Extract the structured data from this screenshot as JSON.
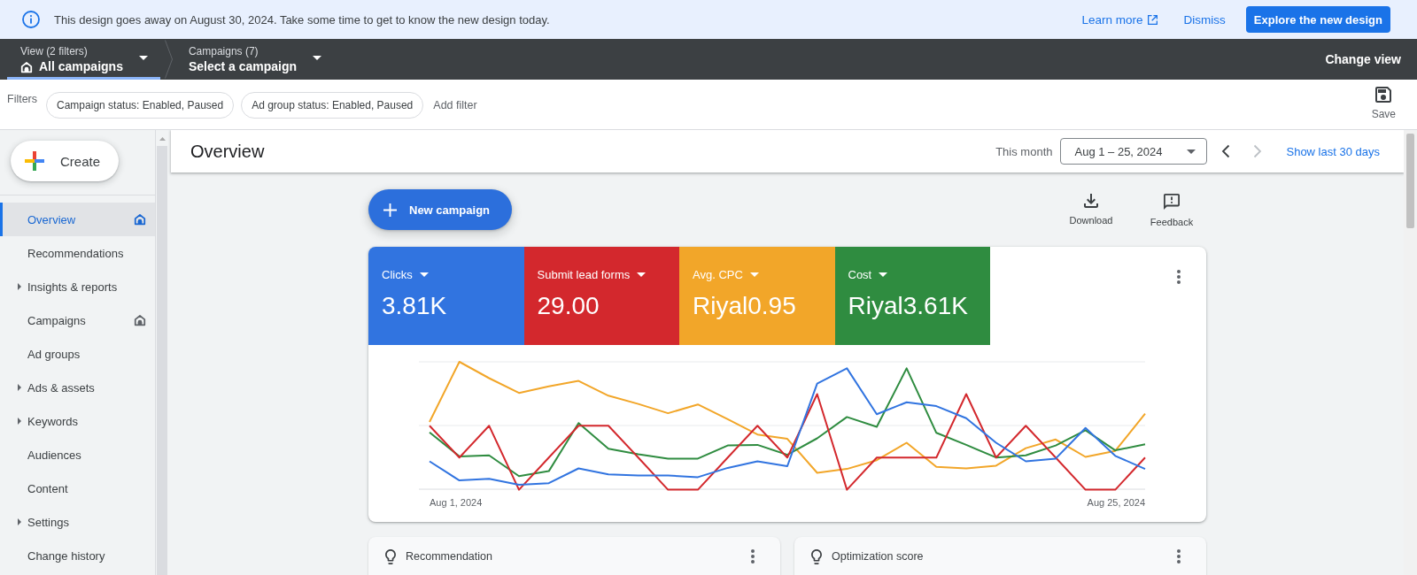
{
  "banner": {
    "message": "This design goes away on August 30, 2024. Take some time to get to know the new design today.",
    "learn_more": "Learn more",
    "dismiss": "Dismiss",
    "explore": "Explore the new design"
  },
  "navbar": {
    "crumbs": [
      {
        "label": "View (2 filters)",
        "value": "All campaigns",
        "home": true,
        "selected": true
      },
      {
        "label": "Campaigns (7)",
        "value": "Select a campaign",
        "home": false,
        "selected": false
      }
    ],
    "change_view": "Change view"
  },
  "filters": {
    "label": "Filters",
    "chips": [
      "Campaign status: Enabled, Paused",
      "Ad group status: Enabled, Paused"
    ],
    "add_filter": "Add filter",
    "save": "Save"
  },
  "sidebar": {
    "create": "Create",
    "items": [
      {
        "label": "Overview",
        "kind": "page",
        "home": true,
        "selected": true
      },
      {
        "label": "Recommendations",
        "kind": "page",
        "home": false,
        "selected": false
      },
      {
        "label": "Insights & reports",
        "kind": "group",
        "home": false,
        "selected": false
      },
      {
        "label": "Campaigns",
        "kind": "page",
        "home": true,
        "selected": false
      },
      {
        "label": "Ad groups",
        "kind": "page",
        "home": false,
        "selected": false
      },
      {
        "label": "Ads & assets",
        "kind": "group",
        "home": false,
        "selected": false
      },
      {
        "label": "Keywords",
        "kind": "group",
        "home": false,
        "selected": false
      },
      {
        "label": "Audiences",
        "kind": "page",
        "home": false,
        "selected": false
      },
      {
        "label": "Content",
        "kind": "page",
        "home": false,
        "selected": false
      },
      {
        "label": "Settings",
        "kind": "group",
        "home": false,
        "selected": false
      },
      {
        "label": "Change history",
        "kind": "page",
        "home": false,
        "selected": false
      }
    ]
  },
  "header": {
    "title": "Overview",
    "range_label": "This month",
    "range": "Aug 1 – 25, 2024",
    "pager": [
      {
        "kind": "prev",
        "disabled": false
      },
      {
        "kind": "next",
        "disabled": true
      }
    ],
    "show_last": "Show last 30 days"
  },
  "toolbar": {
    "new_campaign": "New campaign",
    "tools": [
      {
        "kind": "download",
        "label": "Download"
      },
      {
        "kind": "feedback",
        "label": "Feedback"
      }
    ]
  },
  "metrics": [
    {
      "label": "Clicks",
      "value": "3.81K",
      "color": "#3174e0"
    },
    {
      "label": "Submit lead forms",
      "value": "29.00",
      "color": "#d3282d"
    },
    {
      "label": "Avg. CPC",
      "value": "Riyal0.95",
      "color": "#f2a629"
    },
    {
      "label": "Cost",
      "value": "Riyal3.61K",
      "color": "#2f8c40"
    }
  ],
  "chart": {
    "x_start": "Aug 1, 2024",
    "x_end": "Aug 25, 2024"
  },
  "cards": [
    {
      "title": "Recommendation"
    },
    {
      "title": "Optimization score"
    }
  ]
}
